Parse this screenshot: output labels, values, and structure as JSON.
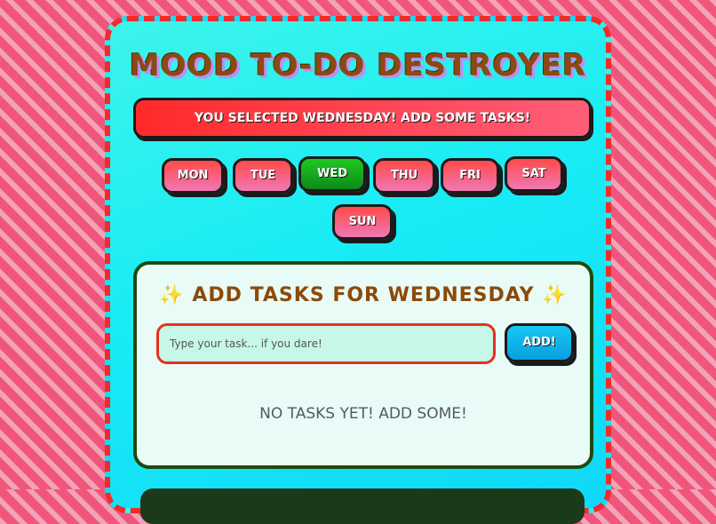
{
  "app": {
    "title": "MOOD TO-DO DESTROYER"
  },
  "banner": {
    "text": "YOU SELECTED WEDNESDAY! ADD SOME TASKS!"
  },
  "days": [
    {
      "label": "MON",
      "active": false
    },
    {
      "label": "TUE",
      "active": false
    },
    {
      "label": "WED",
      "active": true
    },
    {
      "label": "THU",
      "active": false
    },
    {
      "label": "FRI",
      "active": false
    },
    {
      "label": "SAT",
      "active": false
    },
    {
      "label": "SUN",
      "active": false
    }
  ],
  "tasks": {
    "heading": "ADD TASKS FOR WEDNESDAY",
    "sparkle": "✨",
    "input_placeholder": "Type your task... if you dare!",
    "input_value": "",
    "add_label": "ADD!",
    "empty_text": "NO TASKS YET! ADD SOME!"
  },
  "colors": {
    "accent_red": "#f22a2a",
    "active_day": "#20c820",
    "panel_cyan": "#19ecf5",
    "title_brown": "#8b4a12"
  }
}
